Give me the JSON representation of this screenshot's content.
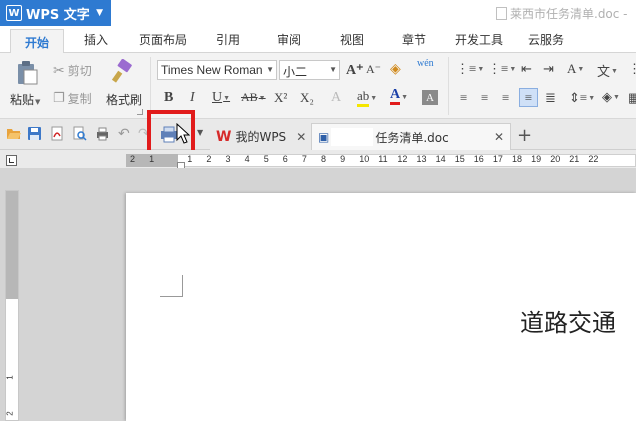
{
  "titlebar": {
    "app_name": "WPS 文字",
    "app_logo": "W",
    "document_title": "莱西市任务清单.doc -"
  },
  "menu": {
    "tabs": [
      "开始",
      "插入",
      "页面布局",
      "引用",
      "审阅",
      "视图",
      "章节",
      "开发工具",
      "云服务"
    ],
    "active": "开始"
  },
  "ribbon": {
    "paste_label": "粘贴",
    "cut_label": "剪切",
    "copy_label": "复制",
    "format_painter_label": "格式刷",
    "font_name": "Times New Roman",
    "font_size": "小二",
    "bold": "B",
    "italic": "I",
    "underline": "U",
    "strike": "AB",
    "superscript": "X²",
    "subscript": "X₂",
    "font_color_letter": "A",
    "clear_format": "A",
    "grow_font": "A⁺",
    "shrink_font": "A⁻",
    "pinyin_label": "wén",
    "highlight_color": "#f5e600",
    "font_color": "#e11b1b"
  },
  "quick_access": {
    "icons": [
      "open-folder-icon",
      "save-icon",
      "export-pdf-icon",
      "print-preview-icon",
      "undo-icon",
      "redo-icon",
      "print-icon"
    ],
    "highlight_color": "#e11b1b"
  },
  "doc_tabs": [
    {
      "label": "我的WPS",
      "icon": "wps-logo-icon",
      "active": false
    },
    {
      "label": "任务清单.doc",
      "icon": "word-doc-icon",
      "active": true
    }
  ],
  "new_tab_symbol": "+",
  "ruler": {
    "h_ticks": [
      "2",
      "1",
      "",
      "1",
      "2",
      "3",
      "4",
      "5",
      "6",
      "7",
      "8",
      "9",
      "10",
      "11",
      "12",
      "13",
      "14",
      "15",
      "16",
      "17",
      "18",
      "19",
      "20",
      "21",
      "22"
    ],
    "v_ticks": [
      "1",
      "2"
    ]
  },
  "document": {
    "visible_text": "道路交通"
  }
}
